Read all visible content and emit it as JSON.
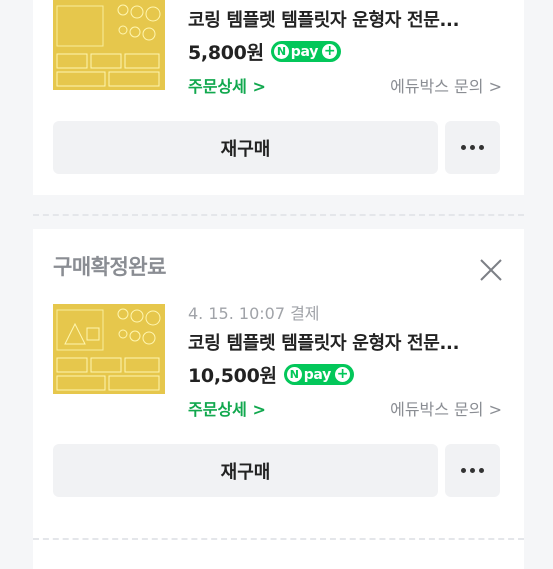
{
  "orders": [
    {
      "status": "",
      "date": "",
      "product_title": "코링 템플렛 템플릿자 운형자 전문...",
      "price": "5,800원",
      "npay_label": "pay",
      "detail_link": "주문상세 >",
      "inquiry_link": "에듀박스 문의 >",
      "rebuy_label": "재구매"
    },
    {
      "status": "구매확정완료",
      "date": "4. 15. 10:07 결제",
      "product_title": "코링 템플렛 템플릿자 운형자 전문...",
      "price": "10,500원",
      "npay_label": "pay",
      "detail_link": "주문상세 >",
      "inquiry_link": "에듀박스 문의 >",
      "rebuy_label": "재구매"
    }
  ],
  "icons": {
    "close": "close-icon",
    "more": "more-dots-icon",
    "npay": "naver-pay-icon"
  },
  "colors": {
    "accent_green": "#11a84e",
    "npay_green": "#03c75a",
    "background": "#f5f6f8"
  }
}
